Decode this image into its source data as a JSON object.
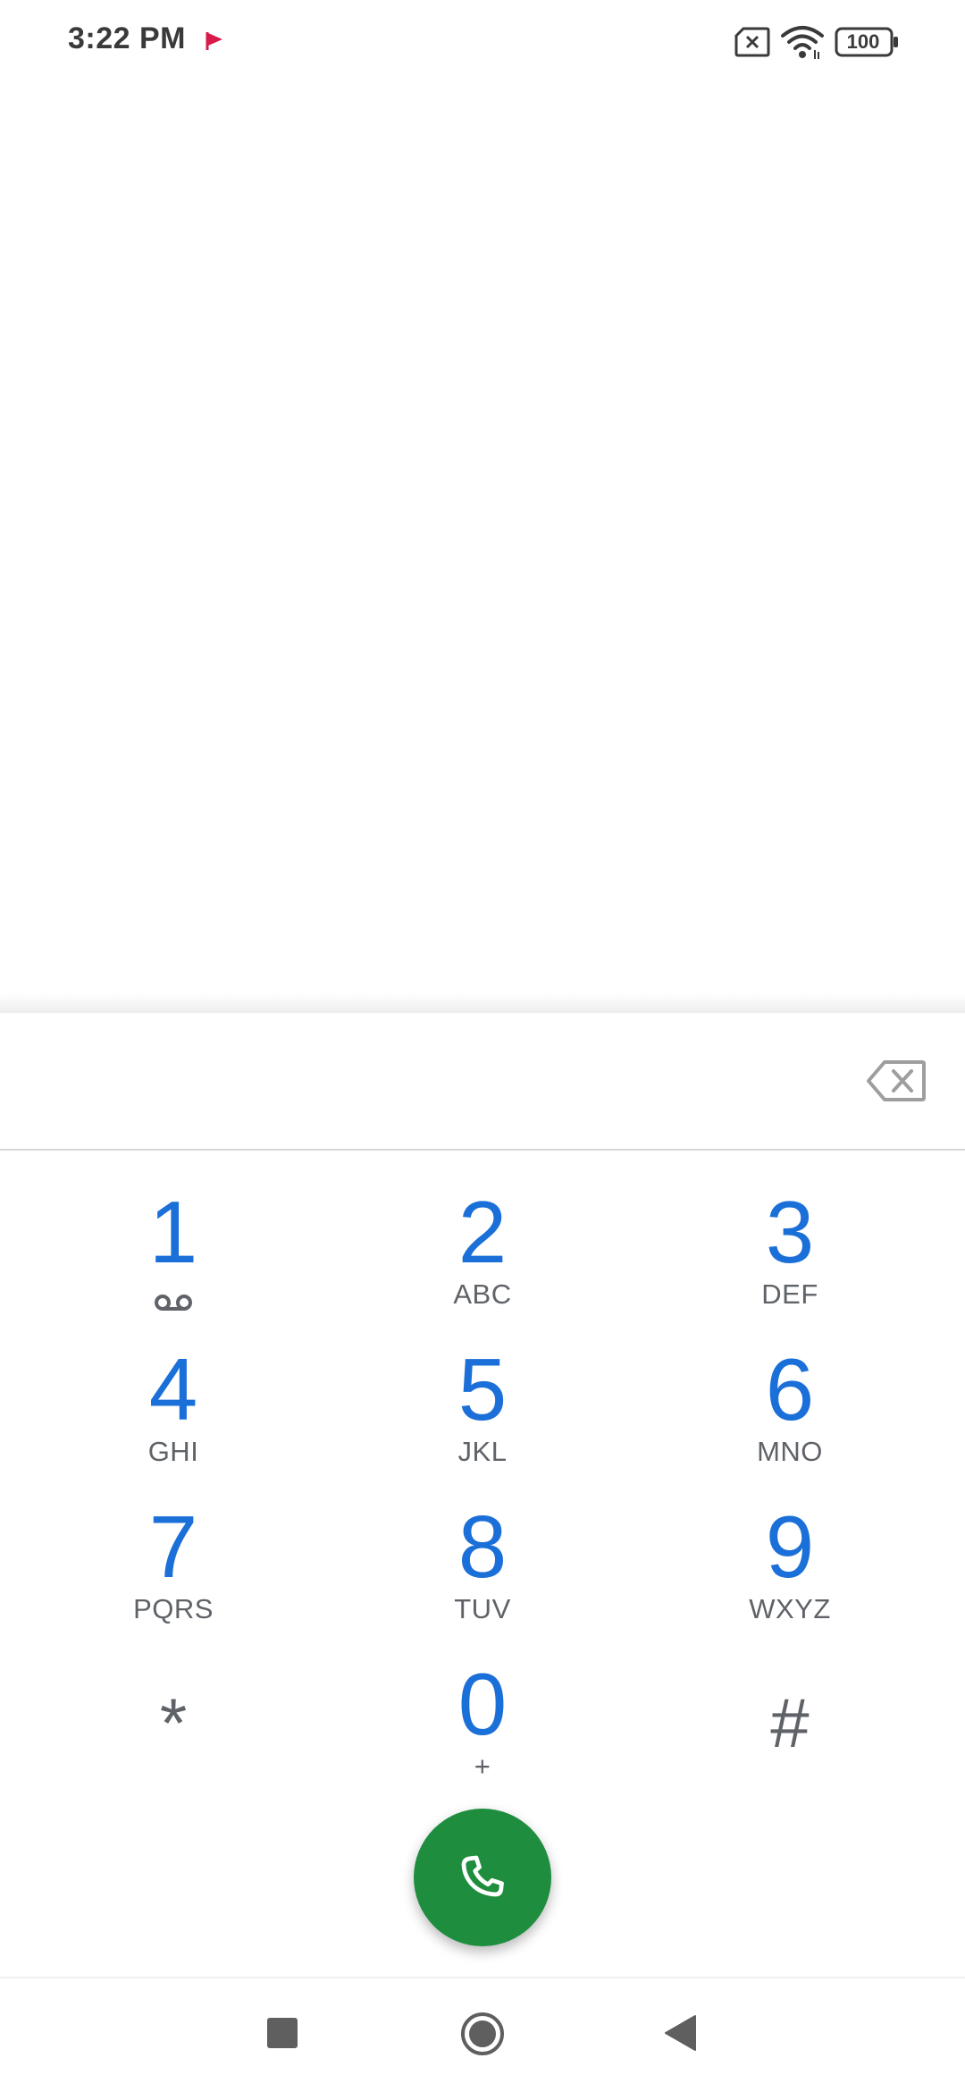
{
  "status_bar": {
    "time": "3:22 PM",
    "battery_level": "100",
    "icons": [
      "flag-icon",
      "sim-missing-icon",
      "wifi-icon",
      "battery-icon"
    ]
  },
  "number_field": {
    "value": "",
    "backspace_icon": "backspace-icon"
  },
  "dialpad": {
    "keys": [
      {
        "digit": "1",
        "letters": "",
        "icon": "voicemail-icon"
      },
      {
        "digit": "2",
        "letters": "ABC"
      },
      {
        "digit": "3",
        "letters": "DEF"
      },
      {
        "digit": "4",
        "letters": "GHI"
      },
      {
        "digit": "5",
        "letters": "JKL"
      },
      {
        "digit": "6",
        "letters": "MNO"
      },
      {
        "digit": "7",
        "letters": "PQRS"
      },
      {
        "digit": "8",
        "letters": "TUV"
      },
      {
        "digit": "9",
        "letters": "WXYZ"
      },
      {
        "symbol": "*"
      },
      {
        "digit": "0",
        "letters": "+"
      },
      {
        "symbol": "#"
      }
    ]
  },
  "call_button": {
    "icon": "phone-icon"
  },
  "nav_bar": {
    "icons": [
      "recents-icon",
      "home-icon",
      "back-icon"
    ]
  },
  "colors": {
    "digit": "#1b6fd8",
    "letters": "#5f6368",
    "call_button": "#1e8e3e",
    "flag": "#d81b4a"
  }
}
